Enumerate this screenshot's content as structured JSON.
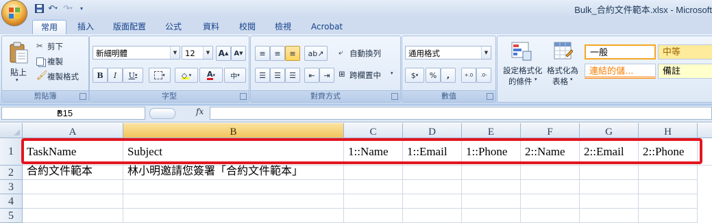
{
  "window": {
    "title": "Bulk_合約文件範本.xlsx - Microsoft",
    "office_button_icon": "office-logo-icon",
    "quick_access": [
      "save-icon",
      "undo-icon",
      "redo-icon",
      "customize-qat-icon"
    ]
  },
  "tabs": [
    "常用",
    "插入",
    "版面配置",
    "公式",
    "資料",
    "校閱",
    "檢視",
    "Acrobat"
  ],
  "active_tab": "常用",
  "ribbon": {
    "clipboard": {
      "paste_label": "貼上",
      "cut_label": "剪下",
      "copy_label": "複製",
      "format_painter_label": "複製格式",
      "group_label": "剪貼簿"
    },
    "font": {
      "font_name": "新細明體",
      "font_size": "12",
      "bold": "B",
      "italic": "I",
      "underline": "U",
      "grow": "A",
      "shrink": "A",
      "font_color_label": "A",
      "group_label": "字型"
    },
    "alignment": {
      "wrap_text_label": "自動換列",
      "merge_center_label": "跨欄置中",
      "group_label": "對齊方式"
    },
    "number": {
      "format": "通用格式",
      "currency": "$",
      "percent": "%",
      "comma": ",",
      "inc_decimal": "←.0 .00",
      "dec_decimal": ".00 →.0",
      "group_label": "數值"
    },
    "styles": {
      "conditional_format_label_1": "設定格式化",
      "conditional_format_label_2": "的條件",
      "format_table_label_1": "格式化為",
      "format_table_label_2": "表格",
      "cell_styles": [
        {
          "label": "一般",
          "bg": "#ffffff",
          "color": "#000000"
        },
        {
          "label": "中等",
          "bg": "#ffeb9c",
          "color": "#9c6500"
        },
        {
          "label": "連結的儲...",
          "bg": "#ffffff",
          "color": "#fa7d00"
        },
        {
          "label": "備註",
          "bg": "#ffffcc",
          "color": "#000000"
        }
      ]
    }
  },
  "formula_bar": {
    "name_box": "B15",
    "fx": "fx",
    "value": ""
  },
  "sheet": {
    "columns": [
      "A",
      "B",
      "C",
      "D",
      "E",
      "F",
      "G",
      "H"
    ],
    "active_column": "B",
    "rows": [
      "1",
      "2",
      "3",
      "4",
      "5"
    ],
    "cells": [
      [
        "TaskName",
        "Subject",
        "1::Name",
        "1::Email",
        "1::Phone",
        "2::Name",
        "2::Email",
        "2::Phone"
      ],
      [
        "合約文件範本",
        "林小明邀請您簽署「合約文件範本」",
        "",
        "",
        "",
        "",
        "",
        ""
      ]
    ]
  },
  "annotation": {
    "color": "#e3151f"
  }
}
